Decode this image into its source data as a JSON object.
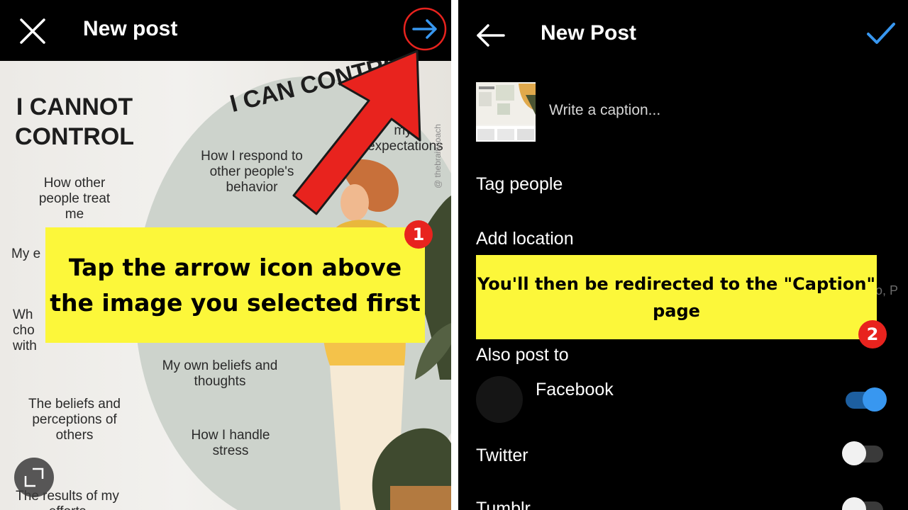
{
  "left_screen": {
    "title": "New post",
    "close_icon": "close-icon",
    "next_icon": "arrow-right-icon",
    "infographic": {
      "heading_left": [
        "I CANNOT",
        "CONTROL"
      ],
      "heading_right": "I CAN CONTROL",
      "items_left": [
        "How other people treat me",
        "My e",
        "Wh cho with their lives",
        "The beliefs and perceptions of others",
        "The results of my efforts"
      ],
      "items_right": [
        "How I respond to other people's behavior",
        "my expectations",
        "My own beliefs and thoughts",
        "How I handle stress"
      ],
      "watermark": "@ thebraincoach"
    },
    "expand_icon": "expand-icon",
    "callout": "Tap the arrow icon above the image you selected first",
    "step": "1",
    "accent": "#3897f0",
    "highlight_color": "#e8231e"
  },
  "right_screen": {
    "title": "New Post",
    "back_icon": "arrow-left-icon",
    "confirm_icon": "checkmark-icon",
    "caption_placeholder": "Write a caption...",
    "tag_people": "Tag people",
    "add_location": "Add location",
    "location_suggestion_fragment": "o, P",
    "also_post_to": "Also post to",
    "networks": [
      {
        "label": "Facebook",
        "enabled": true
      },
      {
        "label": "Twitter",
        "enabled": false
      },
      {
        "label": "Tumblr",
        "enabled": false
      }
    ],
    "callout": "You'll then be redirected to the \"Caption\" page",
    "step": "2",
    "toggle_on_color": "#3897f0"
  }
}
